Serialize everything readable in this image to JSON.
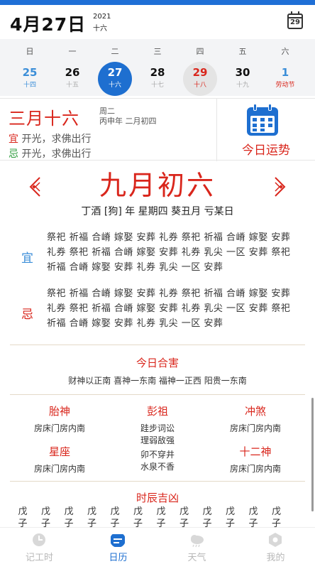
{
  "header": {
    "date": "4月27日",
    "year": "2021",
    "lunar_day": "十六",
    "calendar_button_num": "29"
  },
  "week": {
    "weekdays": [
      "日",
      "一",
      "二",
      "三",
      "四",
      "五",
      "六"
    ],
    "days": [
      {
        "num": "25",
        "sub": "十四",
        "style": "weekend"
      },
      {
        "num": "26",
        "sub": "十五",
        "style": "normal"
      },
      {
        "num": "27",
        "sub": "十六",
        "style": "selected"
      },
      {
        "num": "28",
        "sub": "十七",
        "style": "normal"
      },
      {
        "num": "29",
        "sub": "十八",
        "style": "today"
      },
      {
        "num": "30",
        "sub": "十九",
        "style": "normal"
      },
      {
        "num": "1",
        "sub": "劳动节",
        "style": "weekend-holiday"
      }
    ]
  },
  "summary": {
    "lunar": "三月十六",
    "weekday": "周二",
    "ganzhi": "丙申年 二月初四",
    "yi_label": "宜",
    "yi_text": "开光，求佛出行",
    "ji_label": "忌",
    "ji_text": "开光，求佛出行",
    "fortune_label": "今日运势"
  },
  "detail": {
    "big_lunar": "九月初六",
    "ganzhi_line": "丁酒 [狗] 年  星期四  葵丑月  亏某日",
    "yi_label": "宜",
    "yi_text": "祭祀 祈福 合嵴 嫁娶 安葬 礼券 祭祀 祈福 合嵴 嫁娶 安葬 礼券 祭祀 祈福 合嵴 嫁娶 安葬 礼券 乳尖 一区 安葬 祭祀 祈福 合嵴 嫁娶 安葬 礼券 乳尖 一区 安葬",
    "ji_label": "忌",
    "ji_text": "祭祀 祈福 合嵴 嫁娶 安葬 礼券 祭祀 祈福 合嵴 嫁娶 安葬 礼券 祭祀 祈福 合嵴 嫁娶 安葬 礼券 乳尖 一区 安葬 祭祀 祈福 合嵴 嫁娶 安葬 礼券 乳尖 一区 安葬"
  },
  "hehai": {
    "title": "今日合害",
    "text": "财神以正南 喜神一东南 福神一正西 阳贵一东南"
  },
  "grid": {
    "taishen_title": "胎神",
    "taishen_value": "房床门房内南",
    "pengzu_title": "彭祖",
    "pengzu_line1": "跬步词讼",
    "pengzu_line2": "理弱敌强",
    "chongsha_title": "冲煞",
    "chongsha_value": "房床门房内南",
    "xingzuo_title": "星座",
    "xingzuo_value": "房床门房内南",
    "extra_line1": "卯不穿井",
    "extra_line2": "水泉不香",
    "shiershen_title": "十二神",
    "shiershen_value": "房床门房内南"
  },
  "hours": {
    "title": "时辰吉凶",
    "items": [
      "戊子",
      "戊子",
      "戊子",
      "戊子",
      "戊子",
      "戊子",
      "戊子",
      "戊子",
      "戊子",
      "戊子",
      "戊子",
      "戊子"
    ]
  },
  "nav": {
    "items": [
      "记工时",
      "日历",
      "天气",
      "我的"
    ],
    "active": "日历"
  },
  "colors": {
    "accent_blue": "#1e6fd0",
    "accent_red": "#d9261c",
    "green": "#2d9c3c"
  }
}
